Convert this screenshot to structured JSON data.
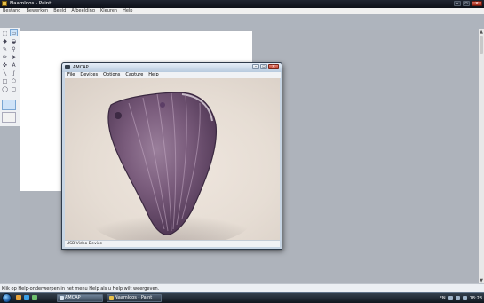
{
  "paint": {
    "title": "Naamloos - Paint",
    "menu": [
      "Bestand",
      "Bewerken",
      "Beeld",
      "Afbeelding",
      "Kleuren",
      "Help"
    ],
    "status_text": "Klik op Help-onderwerpen in het menu Help als u Help wilt weergeven.",
    "colors_fg": "#000000",
    "colors_bg": "#ffffff",
    "palette": [
      "#000000",
      "#808080",
      "#800000",
      "#808000",
      "#008000",
      "#008080",
      "#000080",
      "#800080",
      "#808040",
      "#004040",
      "#0080ff",
      "#004080",
      "#8000ff",
      "#804000",
      "#ffffff",
      "#c0c0c0",
      "#ff0000",
      "#ffff00",
      "#00ff00",
      "#00ffff",
      "#0000ff",
      "#ff00ff",
      "#ffff80",
      "#00ff80",
      "#80ffff",
      "#8080ff",
      "#ff0080",
      "#ff8040"
    ],
    "tools": [
      {
        "name": "free-select-tool",
        "glyph": "⬚",
        "selected": false
      },
      {
        "name": "rect-select-tool",
        "glyph": "▭",
        "selected": true
      },
      {
        "name": "eraser-tool",
        "glyph": "◆",
        "selected": false
      },
      {
        "name": "fill-tool",
        "glyph": "◒",
        "selected": false
      },
      {
        "name": "eyedropper-tool",
        "glyph": "✎",
        "selected": false
      },
      {
        "name": "magnifier-tool",
        "glyph": "⚲",
        "selected": false
      },
      {
        "name": "pencil-tool",
        "glyph": "✏",
        "selected": false
      },
      {
        "name": "brush-tool",
        "glyph": "➤",
        "selected": false
      },
      {
        "name": "airbrush-tool",
        "glyph": "✜",
        "selected": false
      },
      {
        "name": "text-tool",
        "glyph": "A",
        "selected": false
      },
      {
        "name": "line-tool",
        "glyph": "╲",
        "selected": false
      },
      {
        "name": "curve-tool",
        "glyph": "∫",
        "selected": false
      },
      {
        "name": "rectangle-tool",
        "glyph": "□",
        "selected": false
      },
      {
        "name": "polygon-tool",
        "glyph": "⬠",
        "selected": false
      },
      {
        "name": "ellipse-tool",
        "glyph": "◯",
        "selected": false
      },
      {
        "name": "rounded-rect-tool",
        "glyph": "▢",
        "selected": false
      }
    ]
  },
  "amcap": {
    "title": "AMCAP",
    "menu": [
      "File",
      "Devices",
      "Options",
      "Capture",
      "Help"
    ],
    "status_text": "USB Video Device"
  },
  "taskbar": {
    "buttons": [
      "AMCAP",
      "Naamloos - Paint"
    ],
    "language": "EN",
    "clock": "18:28"
  }
}
